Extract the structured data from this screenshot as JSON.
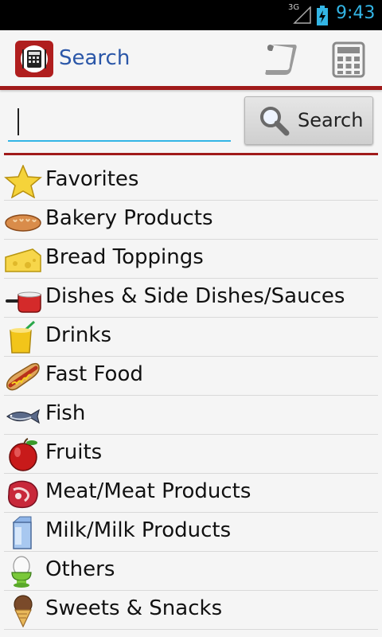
{
  "status": {
    "network": "3G",
    "time": "9:43"
  },
  "action_bar": {
    "title": "Search",
    "scroll_icon": "scroll-icon",
    "calc_icon": "calculator-icon"
  },
  "search": {
    "value": "",
    "placeholder": "",
    "button_label": "Search"
  },
  "categories": [
    {
      "label": "Favorites",
      "icon": "star-icon"
    },
    {
      "label": "Bakery Products",
      "icon": "bread-icon"
    },
    {
      "label": "Bread Toppings",
      "icon": "cheese-icon"
    },
    {
      "label": "Dishes & Side Dishes/Sauces",
      "icon": "saucepan-icon"
    },
    {
      "label": "Drinks",
      "icon": "drink-icon"
    },
    {
      "label": "Fast Food",
      "icon": "hotdog-icon"
    },
    {
      "label": "Fish",
      "icon": "fish-icon"
    },
    {
      "label": "Fruits",
      "icon": "apple-icon"
    },
    {
      "label": "Meat/Meat Products",
      "icon": "meat-icon"
    },
    {
      "label": "Milk/Milk Products",
      "icon": "milk-carton-icon"
    },
    {
      "label": "Others",
      "icon": "egg-icon"
    },
    {
      "label": "Sweets & Snacks",
      "icon": "icecream-icon"
    }
  ],
  "colors": {
    "accent": "#a01a1a",
    "title": "#2b57a8",
    "focus": "#33b5e5"
  }
}
